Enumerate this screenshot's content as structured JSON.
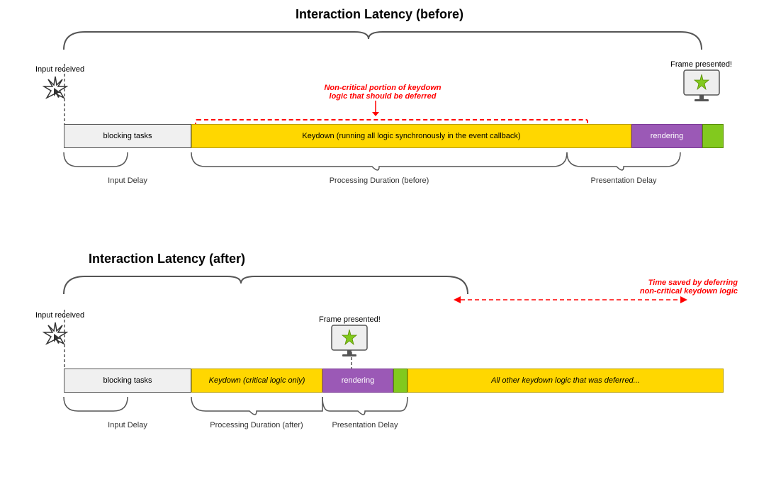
{
  "top": {
    "title": "Interaction Latency (before)",
    "input_received": "Input received",
    "frame_presented": "Frame presented!",
    "defer_annotation_line1": "Non-critical portion of keydown",
    "defer_annotation_line2": "logic that should be deferred",
    "bar_blocking": "blocking tasks",
    "bar_keydown": "Keydown (running all logic synchronously in the event callback)",
    "bar_rendering": "rendering",
    "label_input_delay": "Input Delay",
    "label_processing": "Processing Duration (before)",
    "label_presentation": "Presentation Delay"
  },
  "bottom": {
    "title": "Interaction Latency (after)",
    "input_received": "Input received",
    "frame_presented": "Frame presented!",
    "time_saved_line1": "Time saved by deferring",
    "time_saved_line2": "non-critical keydown logic",
    "bar_blocking": "blocking tasks",
    "bar_keydown": "Keydown (critical logic only)",
    "bar_rendering": "rendering",
    "bar_deferred": "All other keydown logic that was deferred...",
    "label_input_delay": "Input Delay",
    "label_processing": "Processing Duration (after)",
    "label_presentation": "Presentation Delay"
  }
}
